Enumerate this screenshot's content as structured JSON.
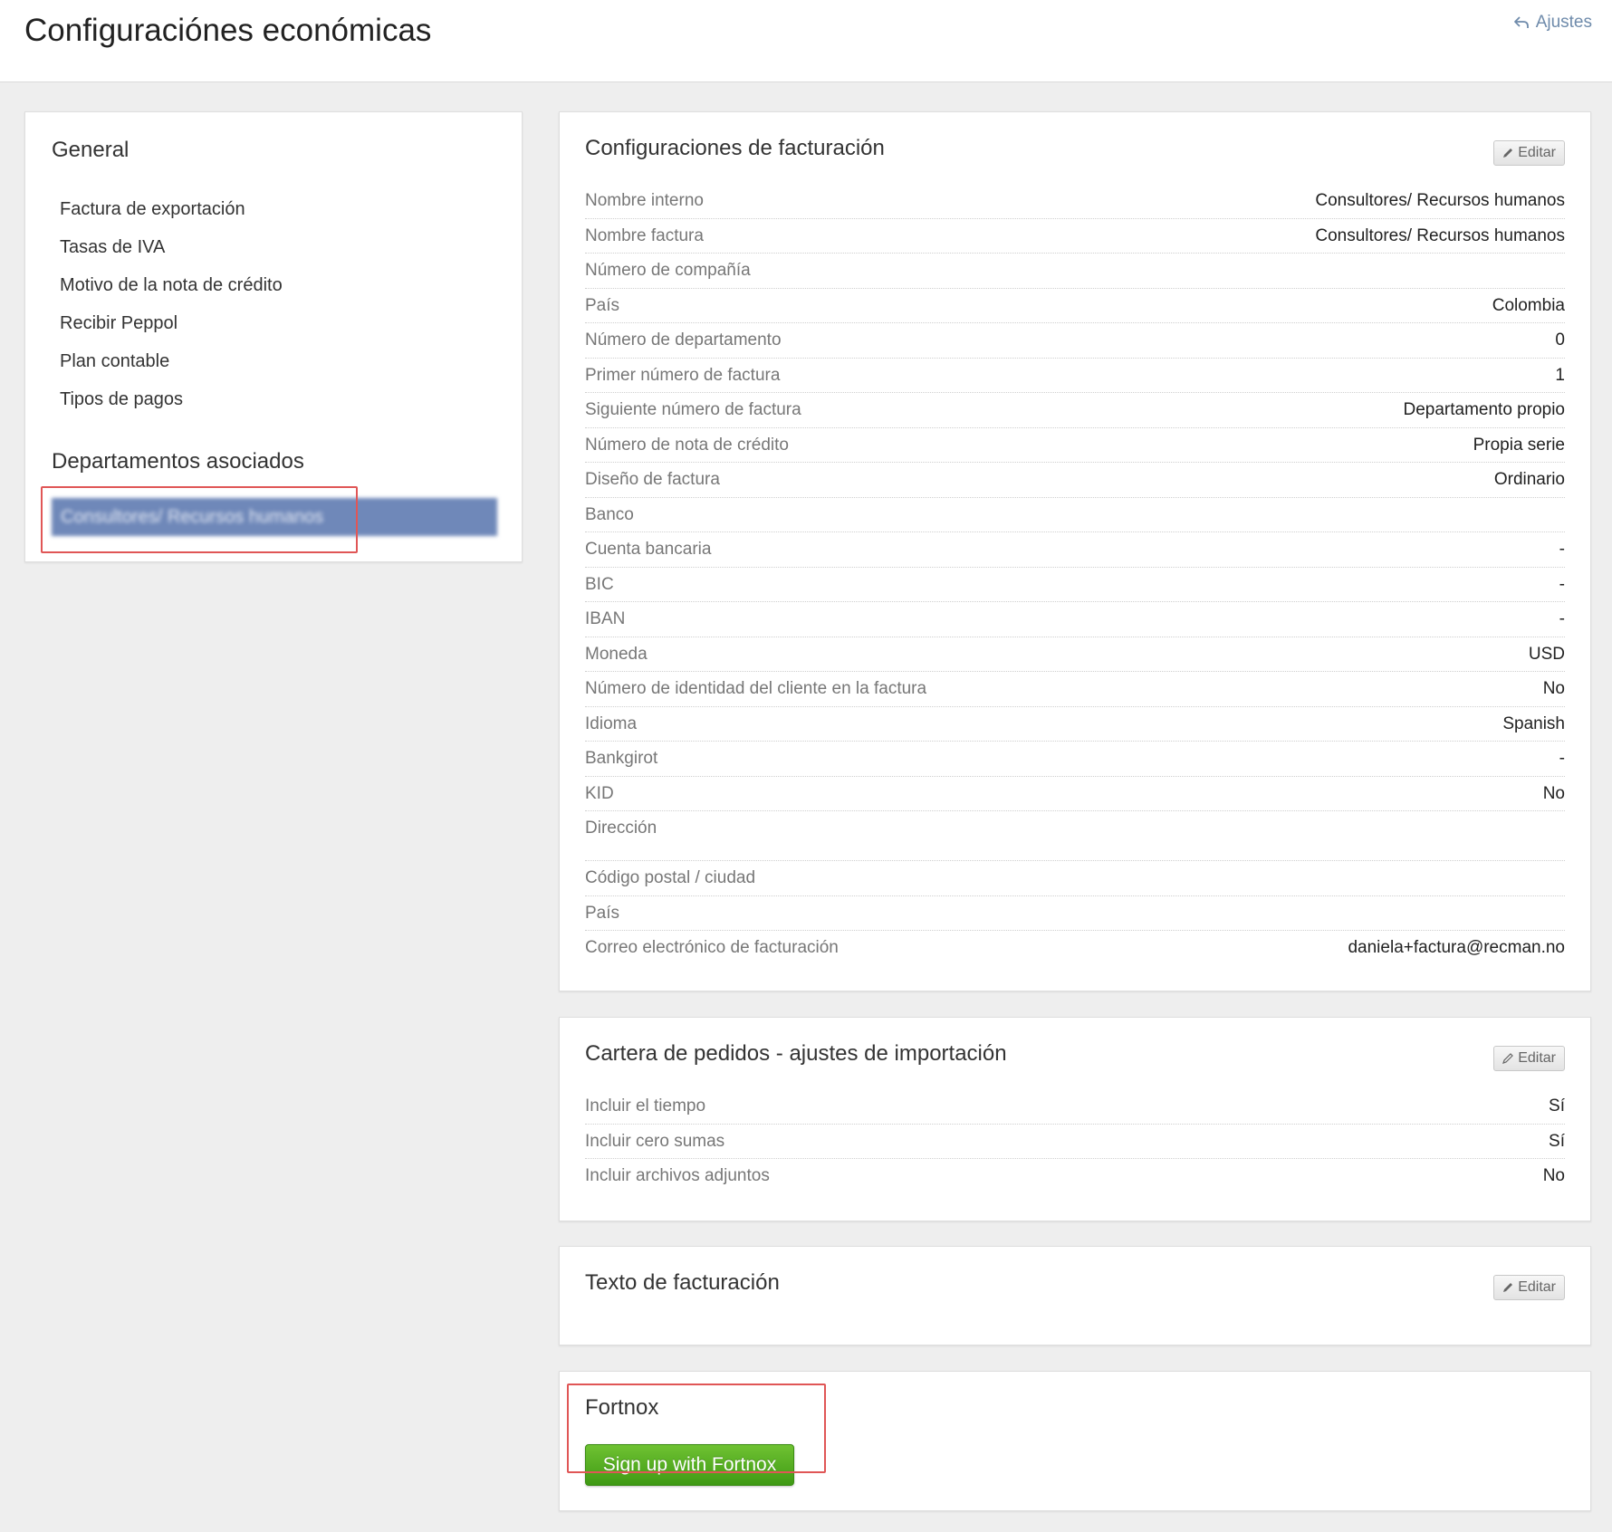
{
  "header": {
    "title": "Configuraciónes económicas",
    "back_label": "Ajustes"
  },
  "sidebar": {
    "general_title": "General",
    "items": [
      {
        "label": "Factura de exportación"
      },
      {
        "label": "Tasas de IVA"
      },
      {
        "label": "Motivo de la nota de crédito"
      },
      {
        "label": "Recibir Peppol"
      },
      {
        "label": "Plan contable"
      },
      {
        "label": "Tipos de pagos"
      }
    ],
    "departments_title": "Departamentos asociados",
    "departments": [
      {
        "label": "Consultores/ Recursos humanos"
      }
    ]
  },
  "billing": {
    "title": "Configuraciones de facturación",
    "edit_label": "Editar",
    "rows": [
      {
        "label": "Nombre interno",
        "value": "Consultores/ Recursos humanos"
      },
      {
        "label": "Nombre factura",
        "value": "Consultores/ Recursos humanos"
      },
      {
        "label": "Número de compañía",
        "value": ""
      },
      {
        "label": "País",
        "value": "Colombia"
      },
      {
        "label": "Número de departamento",
        "value": "0"
      },
      {
        "label": "Primer número de factura",
        "value": "1"
      },
      {
        "label": "Siguiente número de factura",
        "value": "Departamento propio"
      },
      {
        "label": "Número de nota de crédito",
        "value": "Propia serie"
      },
      {
        "label": "Diseño de factura",
        "value": "Ordinario"
      },
      {
        "label": "Banco",
        "value": ""
      },
      {
        "label": "Cuenta bancaria",
        "value": "-"
      },
      {
        "label": "BIC",
        "value": "-"
      },
      {
        "label": "IBAN",
        "value": "-"
      },
      {
        "label": "Moneda",
        "value": "USD"
      },
      {
        "label": "Número de identidad del cliente en la factura",
        "value": "No"
      },
      {
        "label": "Idioma",
        "value": "Spanish"
      },
      {
        "label": "Bankgirot",
        "value": "-"
      },
      {
        "label": "KID",
        "value": "No"
      },
      {
        "label": "Dirección",
        "value": ""
      },
      {
        "label": "Código postal / ciudad",
        "value": ""
      },
      {
        "label": "País",
        "value": ""
      },
      {
        "label": "Correo electrónico de facturación",
        "value": "daniela+factura@recman.no"
      }
    ]
  },
  "order_import": {
    "title": "Cartera de pedidos - ajustes de importación",
    "edit_label": "Editar",
    "rows": [
      {
        "label": "Incluir el tiempo",
        "value": "Sí"
      },
      {
        "label": "Incluir cero sumas",
        "value": "Sí"
      },
      {
        "label": "Incluir archivos adjuntos",
        "value": "No"
      }
    ]
  },
  "billing_text": {
    "title": "Texto de facturación",
    "edit_label": "Editar"
  },
  "fortnox": {
    "title": "Fortnox",
    "button_label": "Sign up with Fortnox"
  },
  "colors": {
    "accent_link": "#6f8bab",
    "selected_department": "#6f88b9",
    "fortnox_green": "#4fa91c",
    "highlight_red": "#e05656"
  }
}
